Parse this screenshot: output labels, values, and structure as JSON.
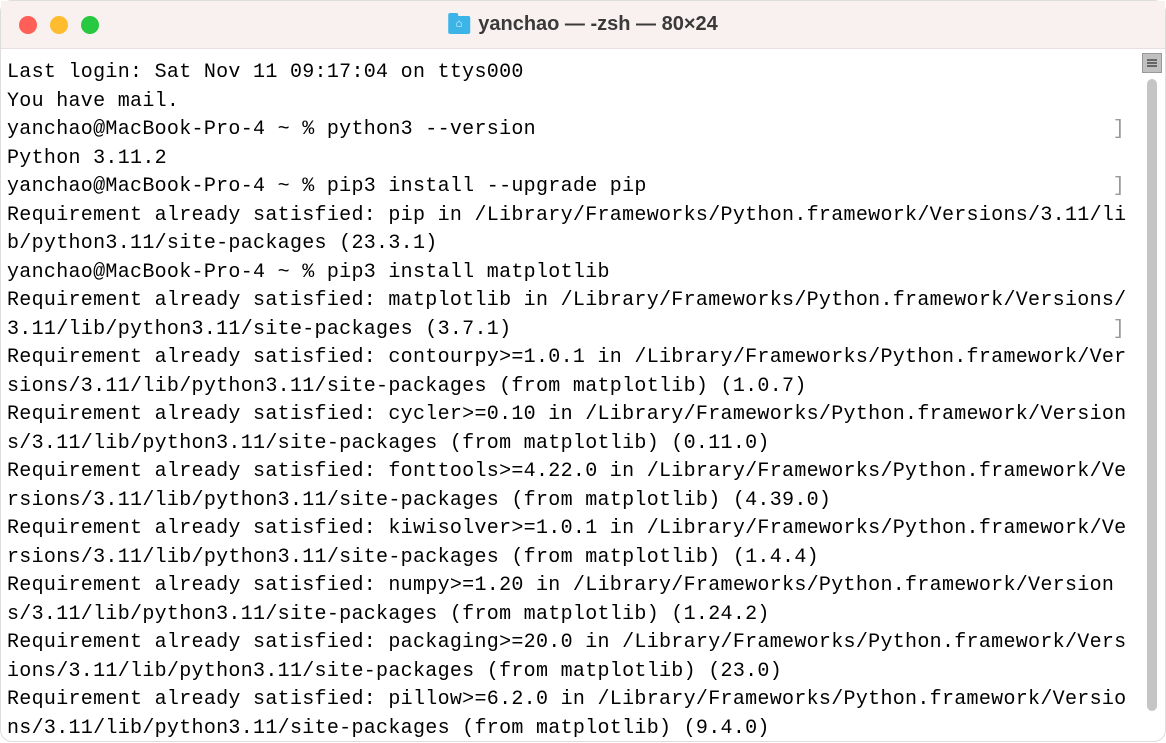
{
  "window": {
    "title": "yanchao — -zsh — 80×24"
  },
  "terminal": {
    "lines": [
      "Last login: Sat Nov 11 09:17:04 on ttys000",
      "You have mail.",
      "yanchao@MacBook-Pro-4 ~ % python3 --version",
      "Python 3.11.2",
      "yanchao@MacBook-Pro-4 ~ % pip3 install --upgrade pip",
      "Requirement already satisfied: pip in /Library/Frameworks/Python.framework/Versions/3.11/lib/python3.11/site-packages (23.3.1)",
      "yanchao@MacBook-Pro-4 ~ % pip3 install matplotlib",
      "Requirement already satisfied: matplotlib in /Library/Frameworks/Python.framework/Versions/3.11/lib/python3.11/site-packages (3.7.1)",
      "Requirement already satisfied: contourpy>=1.0.1 in /Library/Frameworks/Python.framework/Versions/3.11/lib/python3.11/site-packages (from matplotlib) (1.0.7)",
      "Requirement already satisfied: cycler>=0.10 in /Library/Frameworks/Python.framework/Versions/3.11/lib/python3.11/site-packages (from matplotlib) (0.11.0)",
      "Requirement already satisfied: fonttools>=4.22.0 in /Library/Frameworks/Python.framework/Versions/3.11/lib/python3.11/site-packages (from matplotlib) (4.39.0)",
      "Requirement already satisfied: kiwisolver>=1.0.1 in /Library/Frameworks/Python.framework/Versions/3.11/lib/python3.11/site-packages (from matplotlib) (1.4.4)",
      "Requirement already satisfied: numpy>=1.20 in /Library/Frameworks/Python.framework/Versions/3.11/lib/python3.11/site-packages (from matplotlib) (1.24.2)",
      "Requirement already satisfied: packaging>=20.0 in /Library/Frameworks/Python.framework/Versions/3.11/lib/python3.11/site-packages (from matplotlib) (23.0)",
      "Requirement already satisfied: pillow>=6.2.0 in /Library/Frameworks/Python.framework/Versions/3.11/lib/python3.11/site-packages (from matplotlib) (9.4.0)"
    ],
    "promptLineIndices": [
      2,
      4,
      7
    ]
  }
}
